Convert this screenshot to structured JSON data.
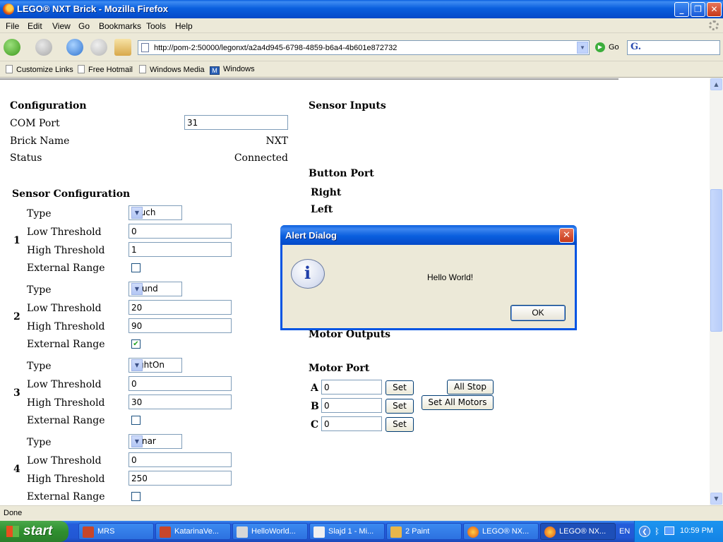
{
  "window": {
    "title": "LEGO® NXT Brick - Mozilla Firefox",
    "minimize_glyph": "_",
    "maximize_glyph": "❐",
    "close_glyph": "✕"
  },
  "menu": {
    "items": [
      "File",
      "Edit",
      "View",
      "Go",
      "Bookmarks",
      "Tools",
      "Help"
    ]
  },
  "toolbar": {
    "url": "http://pom-2:50000/legonxt/a2a4d945-6798-4859-b6a4-4b601e872732",
    "go_label": "Go",
    "search_glyph": "G."
  },
  "bookmarks": [
    "Customize Links",
    "Free Hotmail",
    "Windows Media",
    "Windows"
  ],
  "page": {
    "configuration": {
      "heading": "Configuration",
      "com_port_label": "COM Port",
      "com_port_value": "31",
      "brick_name_label": "Brick Name",
      "brick_name_value": "NXT",
      "status_label": "Status",
      "status_value": "Connected"
    },
    "sensor_configuration": {
      "heading": "Sensor Configuration",
      "type_label": "Type",
      "low_label": "Low Threshold",
      "high_label": "High Threshold",
      "ext_label": "External Range",
      "sensors": [
        {
          "number": "1",
          "type": "Touch",
          "low": "0",
          "high": "1",
          "external_range": false
        },
        {
          "number": "2",
          "type": "Sound",
          "low": "20",
          "high": "90",
          "external_range": true
        },
        {
          "number": "3",
          "type": "LightOn",
          "low": "0",
          "high": "30",
          "external_range": false
        },
        {
          "number": "4",
          "type": "Sonar",
          "low": "0",
          "high": "250",
          "external_range": false
        }
      ]
    },
    "sensor_inputs": {
      "heading": "Sensor Inputs"
    },
    "button_port": {
      "heading": "Button Port",
      "buttons": [
        "Right",
        "Left"
      ]
    },
    "motor_outputs": {
      "heading": "Motor Outputs"
    },
    "motor_port": {
      "heading": "Motor Port",
      "motors": [
        {
          "label": "A",
          "value": "0"
        },
        {
          "label": "B",
          "value": "0"
        },
        {
          "label": "C",
          "value": "0"
        }
      ],
      "set_label": "Set",
      "all_stop_label": "All Stop",
      "set_all_label": "Set All Motors"
    }
  },
  "dialog": {
    "title": "Alert Dialog",
    "message": "Hello World!",
    "ok_label": "OK",
    "icon": "info-icon"
  },
  "status_bar": {
    "text": "Done"
  },
  "taskbar": {
    "start_label": "start",
    "tasks": [
      {
        "label": "MRS",
        "active": false
      },
      {
        "label": "KatarinaVe...",
        "active": false
      },
      {
        "label": "HelloWorld...",
        "active": false
      },
      {
        "label": "Slajd 1 - Mi...",
        "active": false
      },
      {
        "label": "2 Paint",
        "active": false
      },
      {
        "label": "LEGO® NX...",
        "active": false
      },
      {
        "label": "LEGO® NX...",
        "active": true
      }
    ],
    "language": "EN",
    "clock": "10:59 PM"
  },
  "colors": {
    "xp_blue": "#0054e3",
    "checkbox_check": "#21a121",
    "taskbar": "#245ddb",
    "start_green": "#3c9a3c"
  }
}
